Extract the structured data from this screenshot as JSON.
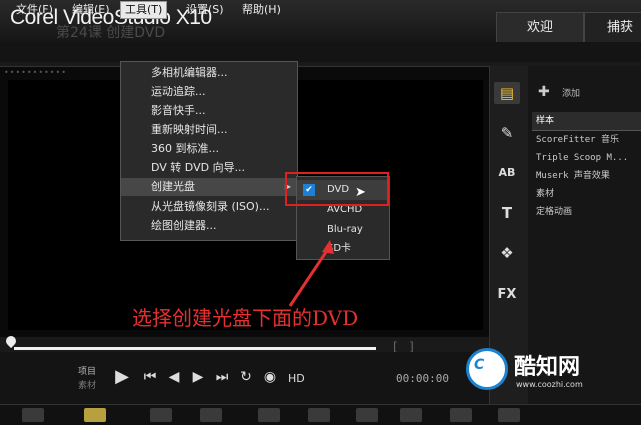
{
  "app": {
    "title": "Corel VideoStudio X10",
    "ghost_subtitle": "第24课 创建DVD"
  },
  "tabs": [
    {
      "label": "欢迎"
    },
    {
      "label": "捕获"
    }
  ],
  "menubar": [
    {
      "label": "文件(F)"
    },
    {
      "label": "编辑(E)"
    },
    {
      "label": "工具(T)"
    },
    {
      "label": "设置(S)"
    },
    {
      "label": "帮助(H)"
    }
  ],
  "tools_menu": [
    {
      "label": "多相机编辑器..."
    },
    {
      "label": "运动追踪..."
    },
    {
      "label": "影音快手..."
    },
    {
      "label": "重新映射时间..."
    },
    {
      "label": "360 到标准..."
    },
    {
      "label": "DV 转 DVD 向导..."
    },
    {
      "label": "创建光盘",
      "has_submenu": true
    },
    {
      "label": "从光盘镜像刻录 (ISO)..."
    },
    {
      "label": "绘图创建器..."
    }
  ],
  "disc_submenu": [
    {
      "label": "DVD",
      "checked": true
    },
    {
      "label": "AVCHD"
    },
    {
      "label": "Blu-ray"
    },
    {
      "label": "SD卡"
    }
  ],
  "library": {
    "add_label": "添加",
    "items": [
      {
        "label": "样本"
      },
      {
        "label": "ScoreFitter 音乐"
      },
      {
        "label": "Triple Scoop M..."
      },
      {
        "label": "Muserk 声音效果"
      },
      {
        "label": "素材"
      },
      {
        "label": "定格动画"
      }
    ]
  },
  "side_icons": [
    {
      "name": "media-icon",
      "glyph": "▤"
    },
    {
      "name": "instant-project-icon",
      "glyph": "✎"
    },
    {
      "name": "transition-icon",
      "glyph": "AB"
    },
    {
      "name": "title-icon",
      "glyph": "T"
    },
    {
      "name": "graphic-icon",
      "glyph": "❖"
    },
    {
      "name": "fx-icon",
      "glyph": "FX"
    }
  ],
  "annotation": "选择创建光盘下面的DVD",
  "player": {
    "project_label": "项目",
    "clip_label": "素材",
    "hd_label": "HD",
    "timecode": "00:00:00"
  },
  "watermark": {
    "name": "酷知网",
    "url": "www.coozhi.com"
  },
  "colors": {
    "highlight_red": "#e02020",
    "check_blue": "#1e7fd6",
    "accent_yellow": "#f4c430"
  }
}
